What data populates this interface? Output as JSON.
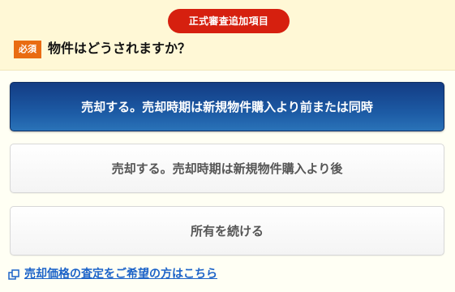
{
  "header": {
    "badge_label": "正式審査追加項目",
    "required_label": "必須",
    "question": "物件はどうされますか？"
  },
  "options": [
    {
      "label": "売却する。売却時期は新規物件購入より前または同時",
      "selected": true
    },
    {
      "label": "売却する。売却時期は新規物件購入より後",
      "selected": false
    },
    {
      "label": "所有を続ける",
      "selected": false
    }
  ],
  "link": {
    "label": "売却価格の査定をご希望の方はこちら",
    "icon": "external-window-icon"
  },
  "colors": {
    "badge_red": "#d6200f",
    "required_orange": "#e96c12",
    "selected_blue": "#1d5ca6",
    "link_blue": "#1c63c8",
    "header_bg": "#fff8d6"
  }
}
